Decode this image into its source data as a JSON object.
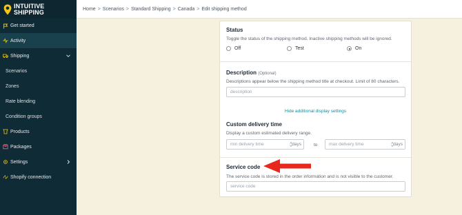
{
  "brand": {
    "line1": "INTUITIVE",
    "line2": "SHIPPING",
    "accent": "#f5c518"
  },
  "sidebar": {
    "items": [
      {
        "label": "Get started",
        "icon": "flag-icon"
      },
      {
        "label": "Activity",
        "icon": "activity-icon"
      },
      {
        "label": "Shipping",
        "icon": "truck-icon"
      },
      {
        "label": "Scenarios"
      },
      {
        "label": "Zones"
      },
      {
        "label": "Rate blending"
      },
      {
        "label": "Condition groups"
      },
      {
        "label": "Products",
        "icon": "products-icon"
      },
      {
        "label": "Packages",
        "icon": "package-icon"
      },
      {
        "label": "Settings",
        "icon": "gear-icon"
      },
      {
        "label": "Shopify connection",
        "icon": "connection-icon"
      }
    ]
  },
  "breadcrumb": [
    "Home",
    "Scenarios",
    "Standard Shipping",
    "Canada",
    "Edit shipping method"
  ],
  "status": {
    "title": "Status",
    "hint": "Toggle the status of the shipping method. Inactive shipping methods will be ignored.",
    "options": [
      "Off",
      "Test",
      "On"
    ],
    "selected": "On"
  },
  "description": {
    "title": "Description",
    "optional": "(Optional)",
    "hint": "Descriptions appear below the shipping method title at checkout. Limit of 80 characters.",
    "placeholder": "description",
    "toggle_link": "Hide additional display settings"
  },
  "delivery": {
    "title": "Custom delivery time",
    "hint": "Display a custom estimated delivery range.",
    "min_placeholder": "min delivery time",
    "max_placeholder": "max delivery time",
    "unit": "days",
    "to": "to"
  },
  "service_code": {
    "title": "Service code",
    "hint": "The service code is stored in the order information and is not visible to the customer.",
    "placeholder": "service code"
  },
  "annotation_color": "#e8281c"
}
